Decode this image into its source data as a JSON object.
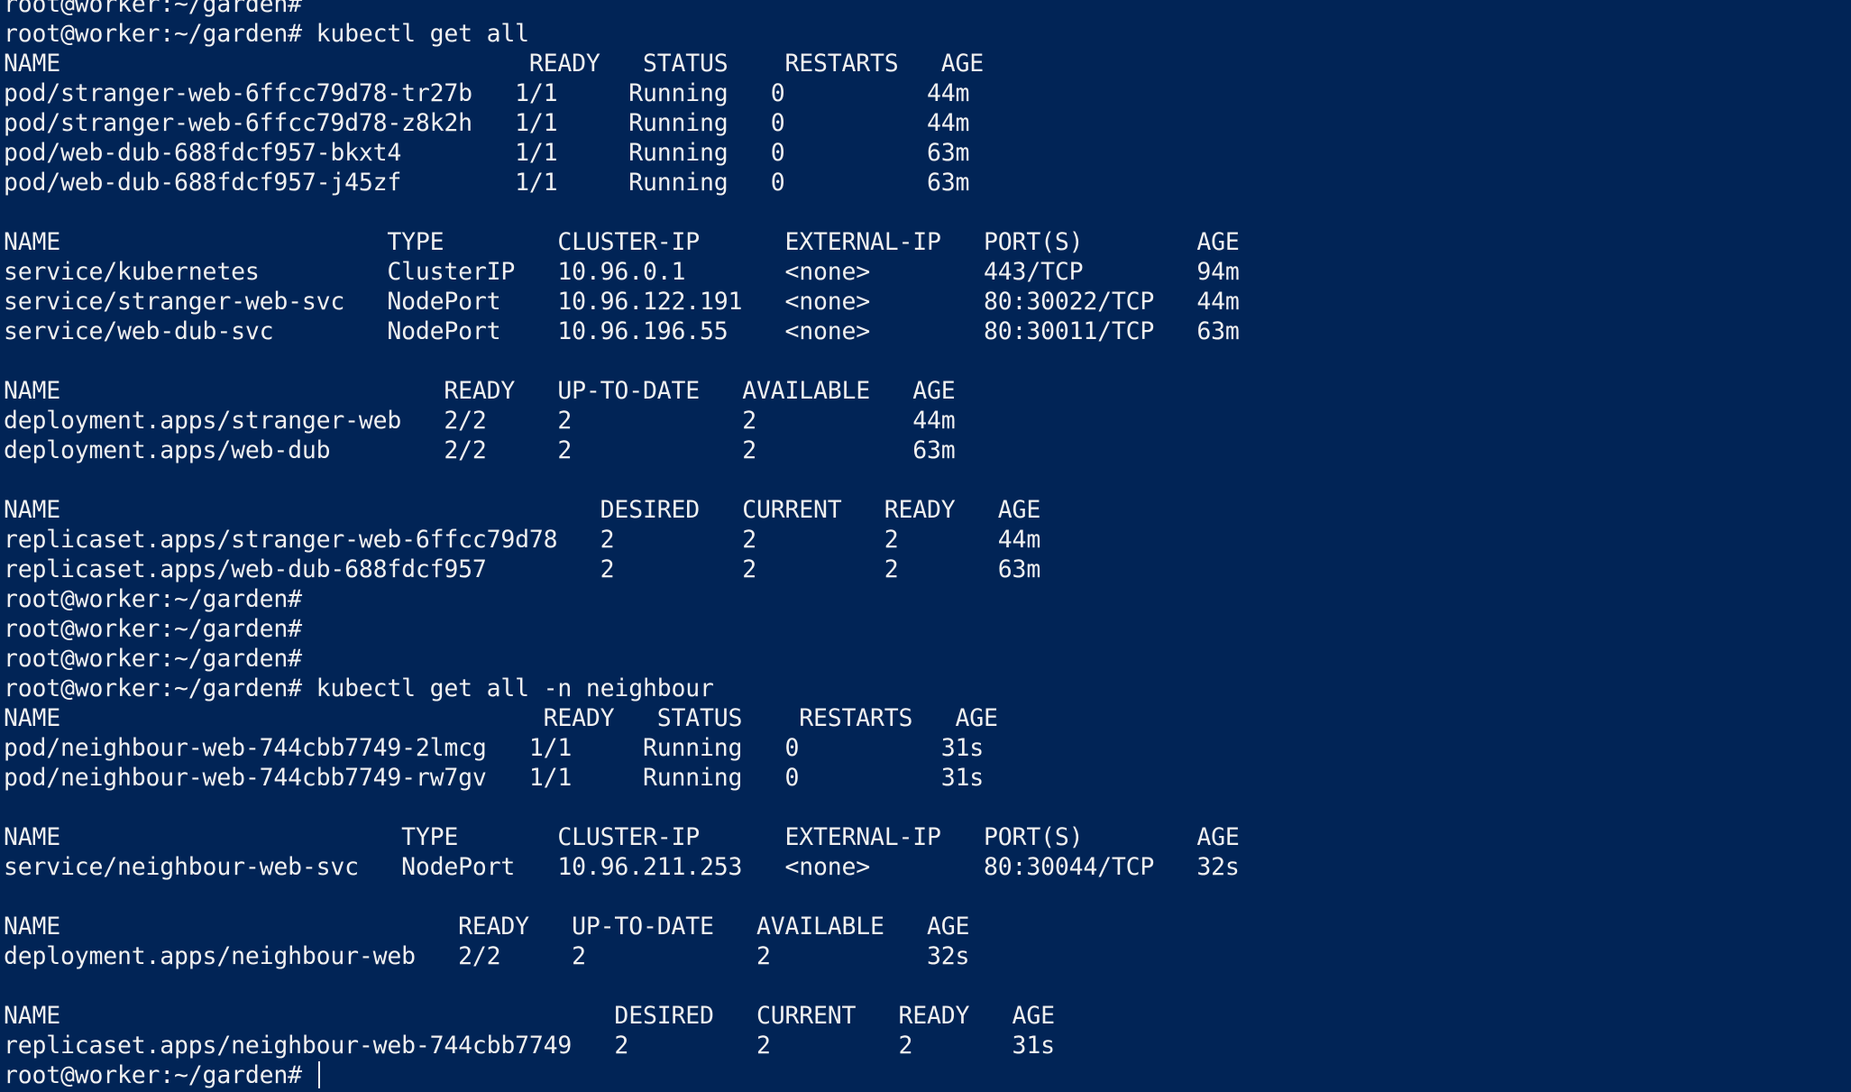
{
  "colors": {
    "background": "#012456",
    "foreground": "#f0f0f0"
  },
  "terminal": {
    "lines": [
      "root@worker:~/garden#",
      "root@worker:~/garden# kubectl get all",
      "NAME                                 READY   STATUS    RESTARTS   AGE",
      "pod/stranger-web-6ffcc79d78-tr27b   1/1     Running   0          44m",
      "pod/stranger-web-6ffcc79d78-z8k2h   1/1     Running   0          44m",
      "pod/web-dub-688fdcf957-bkxt4        1/1     Running   0          63m",
      "pod/web-dub-688fdcf957-j45zf        1/1     Running   0          63m",
      "",
      "NAME                       TYPE        CLUSTER-IP      EXTERNAL-IP   PORT(S)        AGE",
      "service/kubernetes         ClusterIP   10.96.0.1       <none>        443/TCP        94m",
      "service/stranger-web-svc   NodePort    10.96.122.191   <none>        80:30022/TCP   44m",
      "service/web-dub-svc        NodePort    10.96.196.55    <none>        80:30011/TCP   63m",
      "",
      "NAME                           READY   UP-TO-DATE   AVAILABLE   AGE",
      "deployment.apps/stranger-web   2/2     2            2           44m",
      "deployment.apps/web-dub        2/2     2            2           63m",
      "",
      "NAME                                      DESIRED   CURRENT   READY   AGE",
      "replicaset.apps/stranger-web-6ffcc79d78   2         2         2       44m",
      "replicaset.apps/web-dub-688fdcf957        2         2         2       63m",
      "root@worker:~/garden#",
      "root@worker:~/garden#",
      "root@worker:~/garden#",
      "root@worker:~/garden# kubectl get all -n neighbour",
      "NAME                                  READY   STATUS    RESTARTS   AGE",
      "pod/neighbour-web-744cbb7749-2lmcg   1/1     Running   0          31s",
      "pod/neighbour-web-744cbb7749-rw7gv   1/1     Running   0          31s",
      "",
      "NAME                        TYPE       CLUSTER-IP      EXTERNAL-IP   PORT(S)        AGE",
      "service/neighbour-web-svc   NodePort   10.96.211.253   <none>        80:30044/TCP   32s",
      "",
      "NAME                            READY   UP-TO-DATE   AVAILABLE   AGE",
      "deployment.apps/neighbour-web   2/2     2            2           32s",
      "",
      "NAME                                       DESIRED   CURRENT   READY   AGE",
      "replicaset.apps/neighbour-web-744cbb7749   2         2         2       31s"
    ],
    "prompt": "root@worker:~/garden# "
  }
}
